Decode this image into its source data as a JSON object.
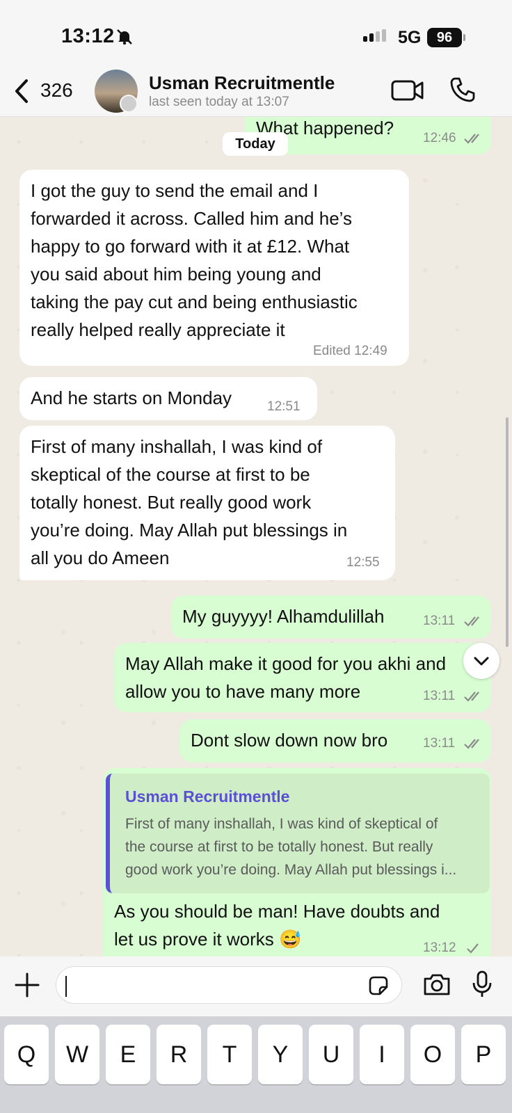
{
  "status_bar": {
    "time": "13:12",
    "network": "5G",
    "battery": "96"
  },
  "header": {
    "back_count": "326",
    "contact_name": "Usman Recruitmentle",
    "contact_status": "last seen today at 13:07"
  },
  "chat": {
    "date_divider": "Today",
    "messages": [
      {
        "direction": "out",
        "text": "What happened?",
        "time": "12:46",
        "edited": ""
      },
      {
        "direction": "in",
        "lines": [
          "I got the guy to send the email and I",
          "forwarded it across. Called him and he’s",
          "happy to go forward with it at £12. What",
          "you said about him being young and",
          "taking the pay cut and being enthusiastic",
          "really helped really appreciate it"
        ],
        "time": "Edited 12:49"
      },
      {
        "direction": "in",
        "text": "And he starts on Monday",
        "time": "12:51"
      },
      {
        "direction": "in",
        "lines": [
          "First of many inshallah, I was kind of",
          "skeptical of the course at first to be",
          "totally honest. But really good work",
          "you’re doing. May Allah put blessings in",
          "all you do Ameen"
        ],
        "time": "12:55"
      },
      {
        "direction": "out",
        "text": "My guyyyy! Alhamdulillah",
        "time": "13:11"
      },
      {
        "direction": "out",
        "lines": [
          "May Allah make it good for you akhi and",
          "allow you to have many more"
        ],
        "time": "13:11"
      },
      {
        "direction": "out",
        "text": "Dont slow down now bro",
        "time": "13:11"
      },
      {
        "direction": "out",
        "quote": {
          "author": "Usman Recruitmentle",
          "lines": [
            "First of many inshallah, I was kind of skeptical of",
            "the course at first to be totally honest. But really",
            "good work you’re doing. May Allah put blessings i..."
          ]
        },
        "lines": [
          "As you should be man! Have doubts and",
          "let us prove it works 😅"
        ],
        "time": "13:12"
      }
    ]
  },
  "composer": {
    "value": ""
  },
  "keyboard": {
    "row1": [
      "Q",
      "W",
      "E",
      "R",
      "T",
      "Y",
      "U",
      "I",
      "O",
      "P"
    ]
  },
  "colors": {
    "incoming": "#ffffff",
    "outgoing": "#d9fdd3",
    "accent": "#5b4fd6",
    "background": "#efeae2"
  }
}
